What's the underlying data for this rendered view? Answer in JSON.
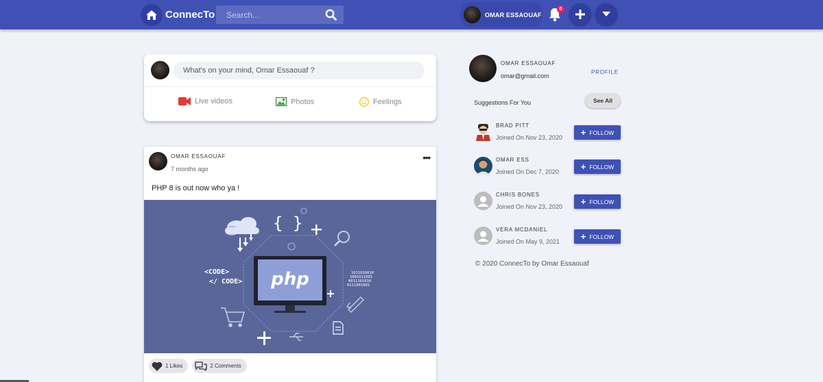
{
  "header": {
    "brand": "ConnecTo",
    "search_placeholder": "Search...",
    "user_name": "OMAR ESSAOUAF",
    "notification_count": "0",
    "colors": {
      "primary": "#3f51b5",
      "dark": "#303f9f",
      "badge": "#e91e63"
    }
  },
  "create_post": {
    "placeholder": "What's on your mind, Omar Essaouaf ?",
    "actions": [
      {
        "label": "Live videos",
        "icon": "video-camera-icon"
      },
      {
        "label": "Photos",
        "icon": "image-icon"
      },
      {
        "label": "Feelings",
        "icon": "smiley-icon"
      }
    ]
  },
  "post": {
    "author": "OMAR ESSAOUAF",
    "time": "7 months ago",
    "text": "PHP 8 is out now who ya !",
    "image": {
      "php_label": "php",
      "code_open": "<CODE>",
      "code_close": "</ CODE>",
      "binary": [
        "1011010010",
        "1001011001",
        "0011101010",
        "0111001001"
      ],
      "braces": "{ }"
    },
    "likes": "1 Likes",
    "comments": "2 Comments"
  },
  "sidebar": {
    "name": "OMAR ESSAOUAF",
    "email": "omar@gmail.com",
    "profile_link": "PROFILE",
    "suggestions_title": "Suggestions For You",
    "see_all": "See All",
    "follow_label": "FOLLOW",
    "suggestions": [
      {
        "name": "BRAD PITT",
        "joined": "Joined On Nov 23, 2020",
        "avatar": "custom"
      },
      {
        "name": "OMAR ESS",
        "joined": "Joined On Dec 7, 2020",
        "avatar": "photo"
      },
      {
        "name": "CHRIS BONES",
        "joined": "Joined On Nov 23, 2020",
        "avatar": "default"
      },
      {
        "name": "VERA MCDANIEL",
        "joined": "Joined On May 9, 2021",
        "avatar": "default"
      }
    ],
    "copyright": "© 2020 ConnecTo by Omar Essaouaf"
  }
}
